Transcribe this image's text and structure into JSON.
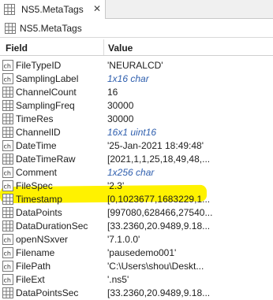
{
  "tab": {
    "label": "NS5.MetaTags",
    "close": "✕"
  },
  "title": "NS5.MetaTags",
  "columns": {
    "field": "Field",
    "value": "Value"
  },
  "highlight_color": "#fff200",
  "rows": [
    {
      "field": "FileTypeID",
      "value": "'NEURALCD'",
      "kind": "text",
      "icon": "char-icon"
    },
    {
      "field": "SamplingLabel",
      "value": "1x16 char",
      "kind": "obj",
      "icon": "char-icon"
    },
    {
      "field": "ChannelCount",
      "value": "16",
      "kind": "text",
      "icon": "numeric-icon"
    },
    {
      "field": "SamplingFreq",
      "value": "30000",
      "kind": "text",
      "icon": "numeric-icon"
    },
    {
      "field": "TimeRes",
      "value": "30000",
      "kind": "text",
      "icon": "numeric-icon"
    },
    {
      "field": "ChannelID",
      "value": "16x1 uint16",
      "kind": "obj",
      "icon": "matrix-icon"
    },
    {
      "field": "DateTime",
      "value": "'25-Jan-2021 18:49:48'",
      "kind": "text",
      "icon": "char-icon"
    },
    {
      "field": "DateTimeRaw",
      "value": "[2021,1,1,25,18,49,48,...",
      "kind": "text",
      "icon": "matrix-icon"
    },
    {
      "field": "Comment",
      "value": "1x256 char",
      "kind": "obj",
      "icon": "char-icon"
    },
    {
      "field": "FileSpec",
      "value": "'2.3'",
      "kind": "text",
      "icon": "char-icon"
    },
    {
      "field": "Timestamp",
      "value": "[0,1023677,1683229,1...",
      "kind": "text",
      "icon": "matrix-icon"
    },
    {
      "field": "DataPoints",
      "value": "[997080,628466,27540...",
      "kind": "text",
      "icon": "matrix-icon"
    },
    {
      "field": "DataDurationSec",
      "value": "[33.2360,20.9489,9.18...",
      "kind": "text",
      "icon": "matrix-icon"
    },
    {
      "field": "openNSxver",
      "value": "'7.1.0.0'",
      "kind": "text",
      "icon": "char-icon"
    },
    {
      "field": "Filename",
      "value": "'pausedemo001'",
      "kind": "text",
      "icon": "char-icon"
    },
    {
      "field": "FilePath",
      "value": "'C:\\Users\\shou\\Deskt...",
      "kind": "text",
      "icon": "char-icon"
    },
    {
      "field": "FileExt",
      "value": "'.ns5'",
      "kind": "text",
      "icon": "char-icon"
    },
    {
      "field": "DataPointsSec",
      "value": "[33.2360,20.9489,9.18...",
      "kind": "text",
      "icon": "matrix-icon"
    }
  ]
}
